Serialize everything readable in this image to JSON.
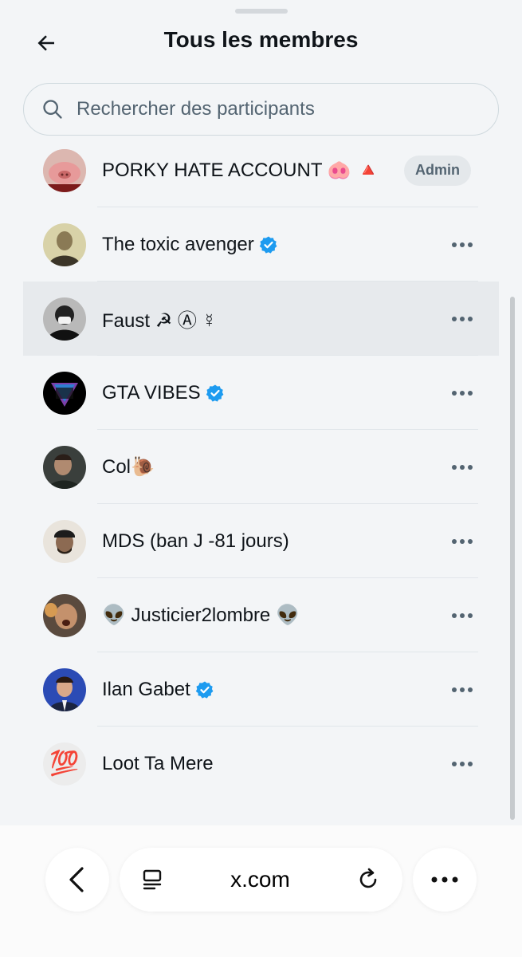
{
  "header": {
    "title": "Tous les membres"
  },
  "search": {
    "placeholder": "Rechercher des participants"
  },
  "members": [
    {
      "name": "PORKY HATE ACCOUNT 🐽 🔺",
      "badge": "Admin",
      "avatar": "pig"
    },
    {
      "name": "The toxic avenger",
      "verified": true,
      "avatar": "photo-man"
    },
    {
      "name": "Faust ☭ Ⓐ ☿",
      "avatar": "photo-mask"
    },
    {
      "name": "GTA VIBES",
      "verified": true,
      "avatar": "gta-logo"
    },
    {
      "name": "Col🐌",
      "avatar": "photo-car"
    },
    {
      "name": "MDS (ban J -81 jours)",
      "avatar": "photo-cap"
    },
    {
      "name": "👽 Justicier2lombre 👽",
      "avatar": "photo-shout"
    },
    {
      "name": "Ilan Gabet",
      "verified": true,
      "avatar": "photo-suit"
    },
    {
      "name": "Loot Ta Mere",
      "avatar": "emoji-100"
    }
  ],
  "avatar_glyphs": {
    "emoji_100": "💯"
  },
  "browser": {
    "url": "x.com"
  },
  "colors": {
    "verified_blue": "#1d9bf0",
    "admin_badge_bg": "#e4e8eb",
    "highlight_row": "#e7eaed"
  }
}
